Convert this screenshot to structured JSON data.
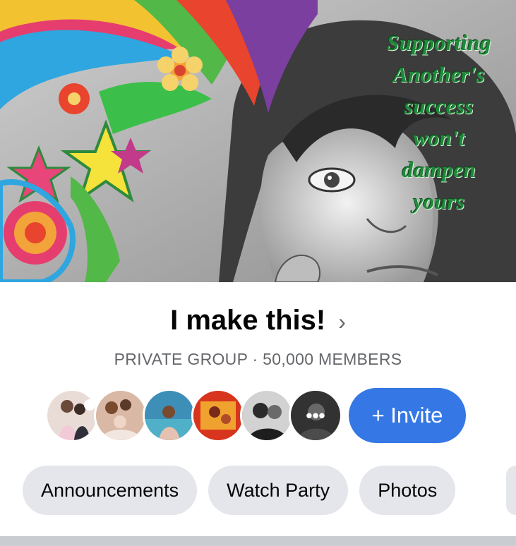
{
  "cover": {
    "quote_lines": [
      "Supporting",
      "Another's",
      "success",
      "won't",
      "dampen",
      "yours"
    ]
  },
  "group": {
    "name": "I make this!",
    "meta": "PRIVATE GROUP · 50,000 MEMBERS"
  },
  "members": {
    "more_glyph": "•••",
    "invite_label": "+ Invite"
  },
  "tabs": [
    "Announcements",
    "Watch Party",
    "Photos"
  ],
  "colors": {
    "accent": "#3578e5",
    "tab_bg": "#e4e6eb",
    "meta_text": "#65676b",
    "quote_green": "#1d8a3a"
  }
}
